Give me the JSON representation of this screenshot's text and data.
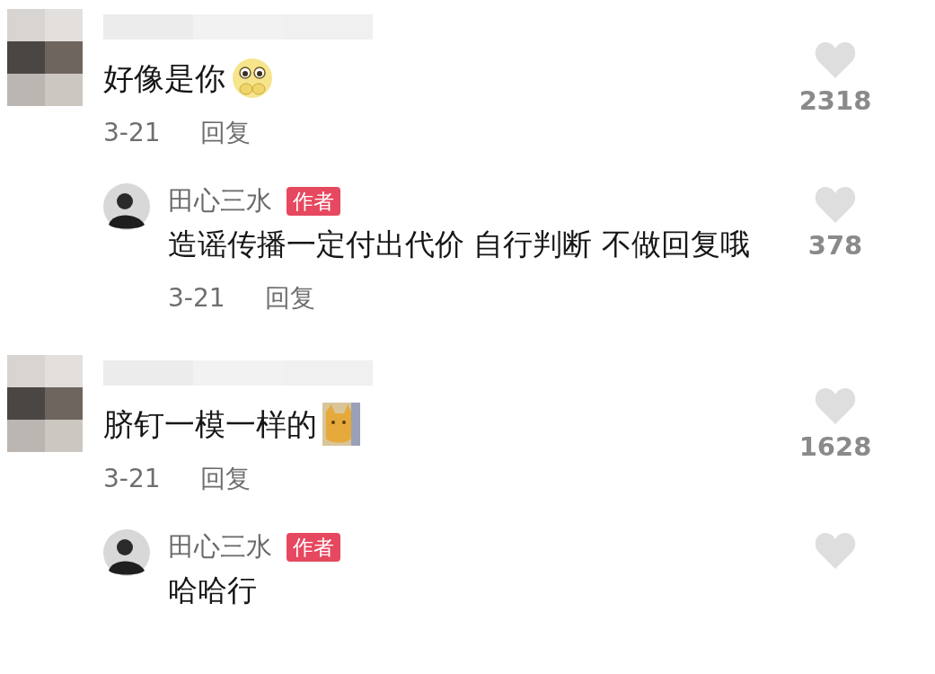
{
  "comments": [
    {
      "text": "好像是你",
      "emoji": {
        "kind": "pleading-face"
      },
      "date": "3-21",
      "reply_label": "回复",
      "likes": "2318",
      "replies": [
        {
          "author": "田心三水",
          "badge": "作者",
          "text": "造谣传播一定付出代价 自行判断 不做回复哦",
          "date": "3-21",
          "reply_label": "回复",
          "likes": "378"
        }
      ]
    },
    {
      "text": "脐钉一模一样的",
      "emoji": {
        "kind": "cat-face"
      },
      "date": "3-21",
      "reply_label": "回复",
      "likes": "1628",
      "replies": [
        {
          "author": "田心三水",
          "badge": "作者",
          "text": "哈哈行"
        }
      ]
    }
  ]
}
